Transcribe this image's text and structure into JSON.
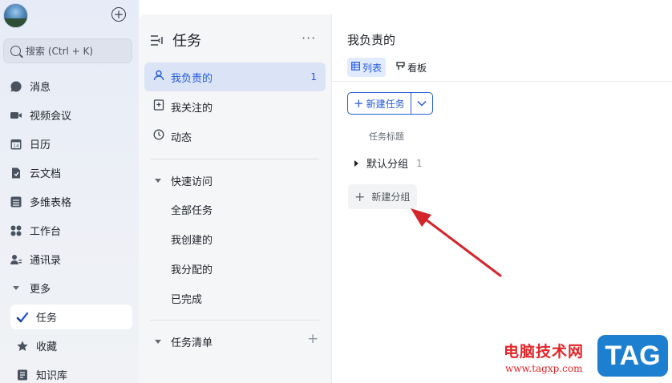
{
  "nav": {
    "search_placeholder": "搜索 (Ctrl + K)",
    "items": [
      {
        "label": "消息",
        "icon": "message-icon"
      },
      {
        "label": "视频会议",
        "icon": "video-icon"
      },
      {
        "label": "日历",
        "icon": "calendar-icon",
        "badge": "14"
      },
      {
        "label": "云文档",
        "icon": "cloud-doc-icon"
      },
      {
        "label": "多维表格",
        "icon": "table-icon"
      },
      {
        "label": "工作台",
        "icon": "workplace-icon"
      },
      {
        "label": "通讯录",
        "icon": "contacts-icon"
      },
      {
        "label": "更多",
        "icon": "chevron-down-icon"
      },
      {
        "label": "任务",
        "icon": "task-check-icon",
        "active": true
      },
      {
        "label": "收藏",
        "icon": "star-icon"
      },
      {
        "label": "知识库",
        "icon": "wiki-icon"
      }
    ]
  },
  "tasks_panel": {
    "title": "任务",
    "more": "···",
    "items": [
      {
        "label": "我负责的",
        "count": "1",
        "selected": true
      },
      {
        "label": "我关注的"
      },
      {
        "label": "动态"
      }
    ],
    "quick_access": {
      "label": "快速访问",
      "items": [
        "全部任务",
        "我创建的",
        "我分配的",
        "已完成"
      ]
    },
    "task_lists": {
      "label": "任务清单",
      "add": "+"
    }
  },
  "main": {
    "title": "我负责的",
    "tabs": [
      {
        "label": "列表",
        "active": true
      },
      {
        "label": "看板",
        "active": false
      }
    ],
    "new_task_label": "新建任务",
    "column_header": "任务标题",
    "group": {
      "name": "默认分组",
      "count": "1"
    },
    "new_group_label": "新建分组"
  },
  "watermark": {
    "text": "电脑技术网",
    "url": "www.tagxp.com",
    "tag": "TAG"
  },
  "colors": {
    "accent": "#245bdb",
    "selected_bg": "#dbe3f6",
    "arrow": "#d3262b"
  }
}
